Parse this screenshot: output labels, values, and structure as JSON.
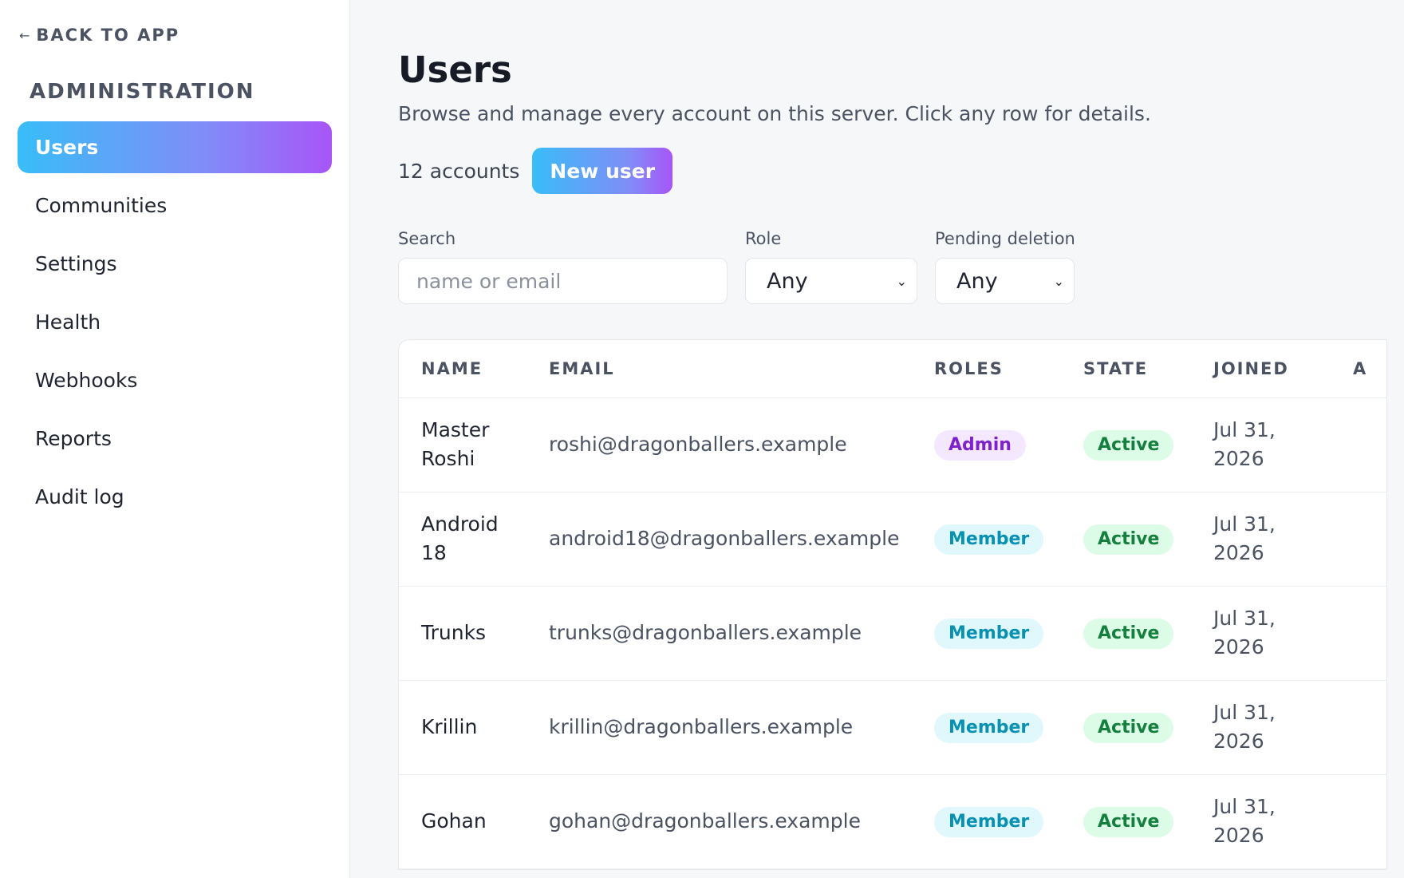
{
  "sidebar": {
    "back_label": "BACK TO APP",
    "back_icon": "arrow-left-icon",
    "heading": "ADMINISTRATION",
    "items": [
      {
        "label": "Users",
        "active": true
      },
      {
        "label": "Communities"
      },
      {
        "label": "Settings"
      },
      {
        "label": "Health"
      },
      {
        "label": "Webhooks"
      },
      {
        "label": "Reports"
      },
      {
        "label": "Audit log"
      }
    ]
  },
  "main": {
    "title": "Users",
    "subtitle": "Browse and manage every account on this server. Click any row for details.",
    "count_text": "12 accounts",
    "new_user_label": "New user",
    "filters": {
      "search_label": "Search",
      "search_placeholder": "name or email",
      "search_value": "",
      "role_label": "Role",
      "role_value": "Any",
      "pending_label": "Pending deletion",
      "pending_value": "Any"
    },
    "table": {
      "headers": {
        "name": "NAME",
        "email": "EMAIL",
        "roles": "ROLES",
        "state": "STATE",
        "joined": "JOINED",
        "extra": "A"
      },
      "rows": [
        {
          "name": "Master Roshi",
          "email": "roshi@dragonballers.example",
          "role": "Admin",
          "state": "Active",
          "joined": "Jul 31, 2026"
        },
        {
          "name": "Android 18",
          "email": "android18@dragonballers.example",
          "role": "Member",
          "state": "Active",
          "joined": "Jul 31, 2026"
        },
        {
          "name": "Trunks",
          "email": "trunks@dragonballers.example",
          "role": "Member",
          "state": "Active",
          "joined": "Jul 31, 2026"
        },
        {
          "name": "Krillin",
          "email": "krillin@dragonballers.example",
          "role": "Member",
          "state": "Active",
          "joined": "Jul 31, 2026"
        },
        {
          "name": "Gohan",
          "email": "gohan@dragonballers.example",
          "role": "Member",
          "state": "Active",
          "joined": "Jul 31, 2026"
        }
      ]
    }
  },
  "colors": {
    "accent_gradient_start": "#38bdf8",
    "accent_gradient_end": "#a855f7",
    "admin_badge": "#7e22ce",
    "member_badge": "#0891b2",
    "active_badge": "#15803d"
  }
}
